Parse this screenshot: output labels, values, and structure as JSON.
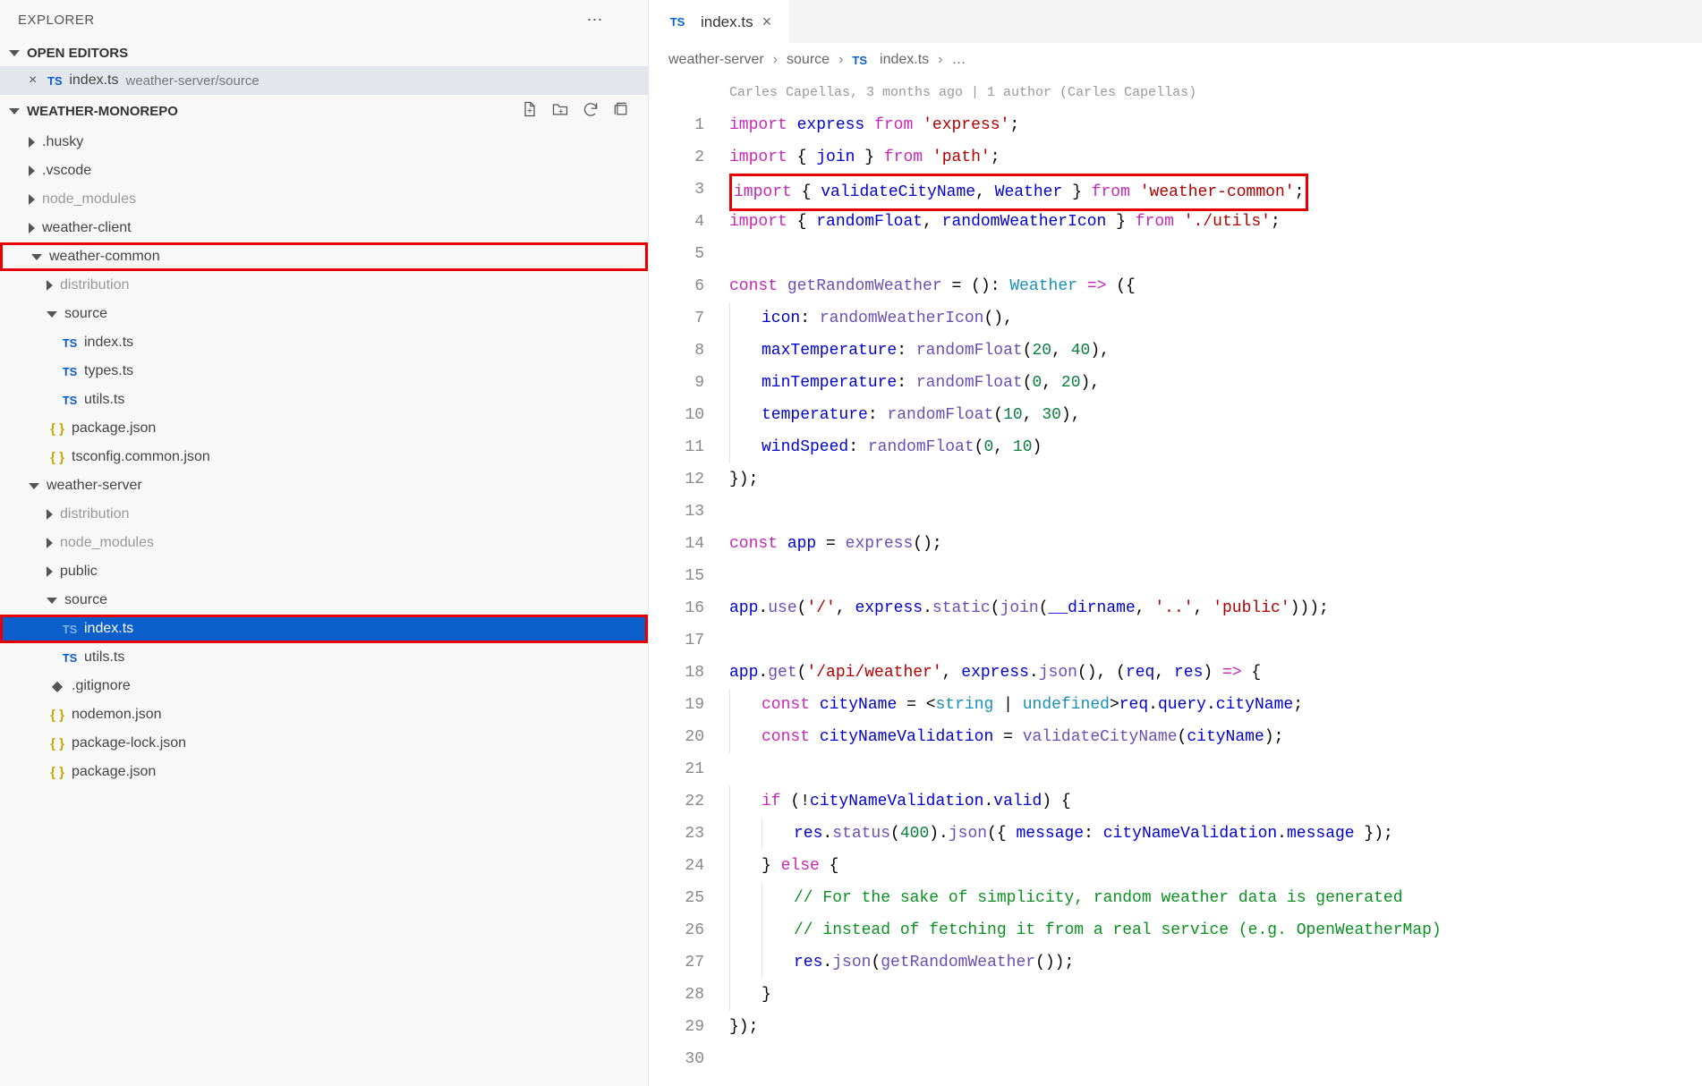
{
  "explorer": {
    "title": "EXPLORER",
    "openEditorsLabel": "OPEN EDITORS",
    "workspaceName": "WEATHER-MONOREPO",
    "openEditors": [
      {
        "name": "index.ts",
        "path": "weather-server/source"
      }
    ],
    "tree": [
      {
        "name": ".husky",
        "type": "folder",
        "expanded": false,
        "depth": 1
      },
      {
        "name": ".vscode",
        "type": "folder",
        "expanded": false,
        "depth": 1
      },
      {
        "name": "node_modules",
        "type": "folder",
        "expanded": false,
        "depth": 1,
        "dim": true
      },
      {
        "name": "weather-client",
        "type": "folder",
        "expanded": false,
        "depth": 1
      },
      {
        "name": "weather-common",
        "type": "folder",
        "expanded": true,
        "depth": 1,
        "highlight": true
      },
      {
        "name": "distribution",
        "type": "folder",
        "expanded": false,
        "depth": 2,
        "dim": true
      },
      {
        "name": "source",
        "type": "folder",
        "expanded": true,
        "depth": 2
      },
      {
        "name": "index.ts",
        "type": "ts",
        "depth": 3
      },
      {
        "name": "types.ts",
        "type": "ts",
        "depth": 3
      },
      {
        "name": "utils.ts",
        "type": "ts",
        "depth": 3
      },
      {
        "name": "package.json",
        "type": "json",
        "depth": 2
      },
      {
        "name": "tsconfig.common.json",
        "type": "json",
        "depth": 2
      },
      {
        "name": "weather-server",
        "type": "folder",
        "expanded": true,
        "depth": 1
      },
      {
        "name": "distribution",
        "type": "folder",
        "expanded": false,
        "depth": 2,
        "dim": true
      },
      {
        "name": "node_modules",
        "type": "folder",
        "expanded": false,
        "depth": 2,
        "dim": true
      },
      {
        "name": "public",
        "type": "folder",
        "expanded": false,
        "depth": 2
      },
      {
        "name": "source",
        "type": "folder",
        "expanded": true,
        "depth": 2
      },
      {
        "name": "index.ts",
        "type": "ts",
        "depth": 3,
        "active": true,
        "highlight": true
      },
      {
        "name": "utils.ts",
        "type": "ts",
        "depth": 3
      },
      {
        "name": ".gitignore",
        "type": "git",
        "depth": 2
      },
      {
        "name": "nodemon.json",
        "type": "json",
        "depth": 2
      },
      {
        "name": "package-lock.json",
        "type": "json",
        "depth": 2
      },
      {
        "name": "package.json",
        "type": "json",
        "depth": 2
      }
    ]
  },
  "tab": {
    "name": "index.ts"
  },
  "breadcrumb": {
    "parts": [
      "weather-server",
      "source",
      "index.ts",
      "…"
    ]
  },
  "blame": {
    "text": "Carles Capellas, 3 months ago | 1 author (Carles Capellas)"
  },
  "code": {
    "lines": [
      [
        [
          "kw",
          "import"
        ],
        [
          "",
          ", "
        ],
        [
          "var",
          "express"
        ],
        [
          "",
          ", "
        ],
        [
          "kw",
          "from"
        ],
        [
          "",
          ", "
        ],
        [
          "str",
          "'express'"
        ],
        [
          "punc",
          ";"
        ]
      ],
      [
        [
          "kw",
          "import"
        ],
        [
          "",
          ", "
        ],
        [
          "punc",
          "{ "
        ],
        [
          "var",
          "join"
        ],
        [
          "punc",
          " } "
        ],
        [
          "kw",
          "from"
        ],
        [
          "",
          ", "
        ],
        [
          "str",
          "'path'"
        ],
        [
          "punc",
          ";"
        ]
      ],
      "HL3",
      [
        [
          "kw",
          "import"
        ],
        [
          "",
          ", "
        ],
        [
          "punc",
          "{ "
        ],
        [
          "var",
          "randomFloat"
        ],
        [
          "punc",
          ", "
        ],
        [
          "var",
          "randomWeatherIcon"
        ],
        [
          "punc",
          " } "
        ],
        [
          "kw",
          "from"
        ],
        [
          "",
          ", "
        ],
        [
          "str",
          "'./utils'"
        ],
        [
          "punc",
          ";"
        ]
      ],
      [],
      [
        [
          "kw",
          "const"
        ],
        [
          "",
          ", "
        ],
        [
          "fn",
          "getRandomWeather"
        ],
        [
          "",
          ", "
        ],
        [
          "op",
          "="
        ],
        [
          "",
          ", "
        ],
        [
          "punc",
          "()"
        ],
        [
          "op",
          ":"
        ],
        [
          "",
          ", "
        ],
        [
          "type",
          "Weather"
        ],
        [
          "",
          ", "
        ],
        [
          "kw",
          "=>"
        ],
        [
          "",
          ", "
        ],
        [
          "punc",
          "({"
        ]
      ],
      [
        [
          "i",
          1
        ],
        [
          "var",
          "icon"
        ],
        [
          "op",
          ":"
        ],
        [
          "",
          ", "
        ],
        [
          "fn",
          "randomWeatherIcon"
        ],
        [
          "punc",
          "(),"
        ]
      ],
      [
        [
          "i",
          1
        ],
        [
          "var",
          "maxTemperature"
        ],
        [
          "op",
          ":"
        ],
        [
          "",
          ", "
        ],
        [
          "fn",
          "randomFloat"
        ],
        [
          "punc",
          "("
        ],
        [
          "num",
          "20"
        ],
        [
          "punc",
          ", "
        ],
        [
          "num",
          "40"
        ],
        [
          "punc",
          "),"
        ]
      ],
      [
        [
          "i",
          1
        ],
        [
          "var",
          "minTemperature"
        ],
        [
          "op",
          ":"
        ],
        [
          "",
          ", "
        ],
        [
          "fn",
          "randomFloat"
        ],
        [
          "punc",
          "("
        ],
        [
          "num",
          "0"
        ],
        [
          "punc",
          ", "
        ],
        [
          "num",
          "20"
        ],
        [
          "punc",
          "),"
        ]
      ],
      [
        [
          "i",
          1
        ],
        [
          "var",
          "temperature"
        ],
        [
          "op",
          ":"
        ],
        [
          "",
          ", "
        ],
        [
          "fn",
          "randomFloat"
        ],
        [
          "punc",
          "("
        ],
        [
          "num",
          "10"
        ],
        [
          "punc",
          ", "
        ],
        [
          "num",
          "30"
        ],
        [
          "punc",
          "),"
        ]
      ],
      [
        [
          "i",
          1
        ],
        [
          "var",
          "windSpeed"
        ],
        [
          "op",
          ":"
        ],
        [
          "",
          ", "
        ],
        [
          "fn",
          "randomFloat"
        ],
        [
          "punc",
          "("
        ],
        [
          "num",
          "0"
        ],
        [
          "punc",
          ", "
        ],
        [
          "num",
          "10"
        ],
        [
          "punc",
          ")"
        ]
      ],
      [
        [
          "punc",
          "});"
        ]
      ],
      [],
      [
        [
          "kw",
          "const"
        ],
        [
          "",
          ", "
        ],
        [
          "var",
          "app"
        ],
        [
          "",
          ", "
        ],
        [
          "op",
          "="
        ],
        [
          "",
          ", "
        ],
        [
          "fn",
          "express"
        ],
        [
          "punc",
          "();"
        ]
      ],
      [],
      [
        [
          "var",
          "app"
        ],
        [
          "punc",
          "."
        ],
        [
          "fn",
          "use"
        ],
        [
          "punc",
          "("
        ],
        [
          "str",
          "'/'"
        ],
        [
          "punc",
          ", "
        ],
        [
          "var",
          "express"
        ],
        [
          "punc",
          "."
        ],
        [
          "fn",
          "static"
        ],
        [
          "punc",
          "("
        ],
        [
          "fn",
          "join"
        ],
        [
          "punc",
          "("
        ],
        [
          "var",
          "__dirname"
        ],
        [
          "punc",
          ", "
        ],
        [
          "str",
          "'..'"
        ],
        [
          "punc",
          ", "
        ],
        [
          "str",
          "'public'"
        ],
        [
          "punc",
          ")));"
        ]
      ],
      [],
      [
        [
          "var",
          "app"
        ],
        [
          "punc",
          "."
        ],
        [
          "fn",
          "get"
        ],
        [
          "punc",
          "("
        ],
        [
          "str",
          "'/api/weather'"
        ],
        [
          "punc",
          ", "
        ],
        [
          "var",
          "express"
        ],
        [
          "punc",
          "."
        ],
        [
          "fn",
          "json"
        ],
        [
          "punc",
          "(), ("
        ],
        [
          "var",
          "req"
        ],
        [
          "punc",
          ", "
        ],
        [
          "var",
          "res"
        ],
        [
          "punc",
          ") "
        ],
        [
          "kw",
          "=>"
        ],
        [
          "punc",
          " {"
        ]
      ],
      [
        [
          "i",
          1
        ],
        [
          "kw",
          "const"
        ],
        [
          "",
          ", "
        ],
        [
          "var",
          "cityName"
        ],
        [
          "",
          ", "
        ],
        [
          "op",
          "="
        ],
        [
          "",
          ", "
        ],
        [
          "punc",
          "<"
        ],
        [
          "type",
          "string"
        ],
        [
          "punc",
          " | "
        ],
        [
          "type",
          "undefined"
        ],
        [
          "punc",
          ">"
        ],
        [
          "var",
          "req"
        ],
        [
          "punc",
          "."
        ],
        [
          "var",
          "query"
        ],
        [
          "punc",
          "."
        ],
        [
          "var",
          "cityName"
        ],
        [
          "punc",
          ";"
        ]
      ],
      [
        [
          "i",
          1
        ],
        [
          "kw",
          "const"
        ],
        [
          "",
          ", "
        ],
        [
          "var",
          "cityNameValidation"
        ],
        [
          "",
          ", "
        ],
        [
          "op",
          "="
        ],
        [
          "",
          ", "
        ],
        [
          "fn",
          "validateCityName"
        ],
        [
          "punc",
          "("
        ],
        [
          "var",
          "cityName"
        ],
        [
          "punc",
          ");"
        ]
      ],
      [],
      [
        [
          "i",
          1
        ],
        [
          "kw",
          "if"
        ],
        [
          "",
          ", "
        ],
        [
          "punc",
          "(!"
        ],
        [
          "var",
          "cityNameValidation"
        ],
        [
          "punc",
          "."
        ],
        [
          "var",
          "valid"
        ],
        [
          "punc",
          ") {"
        ]
      ],
      [
        [
          "i",
          2
        ],
        [
          "var",
          "res"
        ],
        [
          "punc",
          "."
        ],
        [
          "fn",
          "status"
        ],
        [
          "punc",
          "("
        ],
        [
          "num",
          "400"
        ],
        [
          "punc",
          ")."
        ],
        [
          "fn",
          "json"
        ],
        [
          "punc",
          "({ "
        ],
        [
          "var",
          "message"
        ],
        [
          "op",
          ":"
        ],
        [
          "",
          ", "
        ],
        [
          "var",
          "cityNameValidation"
        ],
        [
          "punc",
          "."
        ],
        [
          "var",
          "message"
        ],
        [
          "punc",
          " });"
        ]
      ],
      [
        [
          "i",
          1
        ],
        [
          "punc",
          "} "
        ],
        [
          "kw",
          "else"
        ],
        [
          "punc",
          " {"
        ]
      ],
      [
        [
          "i",
          2
        ],
        [
          "comm",
          "// For the sake of simplicity, random weather data is generated"
        ]
      ],
      [
        [
          "i",
          2
        ],
        [
          "comm",
          "// instead of fetching it from a real service (e.g. OpenWeatherMap)"
        ]
      ],
      [
        [
          "i",
          2
        ],
        [
          "var",
          "res"
        ],
        [
          "punc",
          "."
        ],
        [
          "fn",
          "json"
        ],
        [
          "punc",
          "("
        ],
        [
          "fn",
          "getRandomWeather"
        ],
        [
          "punc",
          "());"
        ]
      ],
      [
        [
          "i",
          1
        ],
        [
          "punc",
          "}"
        ]
      ],
      [
        [
          "punc",
          "});"
        ]
      ],
      []
    ],
    "line3": {
      "import": "import",
      "ob": "{ ",
      "v1": "validateCityName",
      "c1": ", ",
      "v2": "Weather",
      "cb": " } ",
      "from": "from",
      "sp": " ",
      "str": "'weather-common'",
      "semi": ";"
    }
  }
}
